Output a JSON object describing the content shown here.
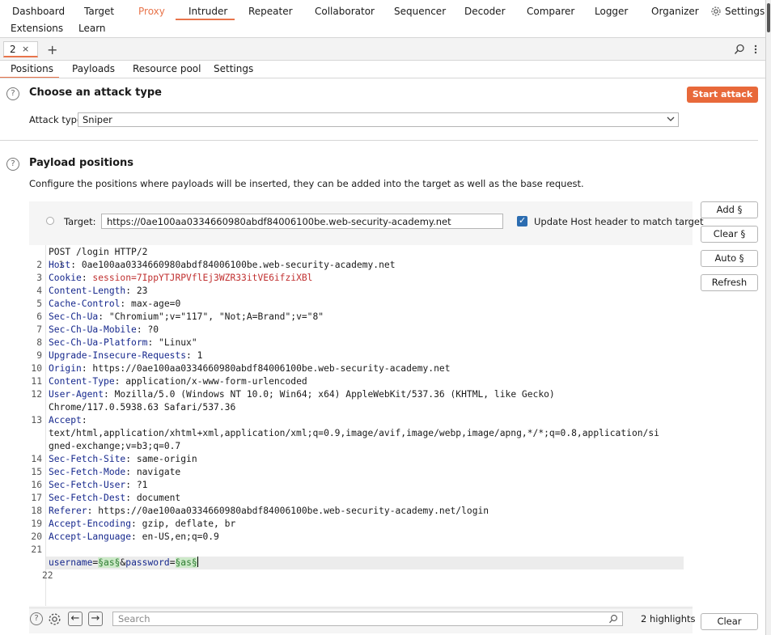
{
  "nav": {
    "row1": [
      "Dashboard",
      "Target",
      "Proxy",
      "Intruder",
      "Repeater",
      "Collaborator",
      "Sequencer",
      "Decoder",
      "Comparer",
      "Logger",
      "Organizer",
      "Settings"
    ],
    "row2": [
      "Extensions",
      "Learn"
    ],
    "active": "Intruder",
    "highlight": "Proxy"
  },
  "tabs": {
    "current": "2",
    "close": "×",
    "add": "+"
  },
  "subtabs": [
    "Positions",
    "Payloads",
    "Resource pool",
    "Settings"
  ],
  "attack": {
    "title": "Choose an attack type",
    "start_label": "Start attack",
    "type_label": "Attack type:",
    "type_value": "Sniper"
  },
  "positions": {
    "title": "Payload positions",
    "description": "Configure the positions where payloads will be inserted, they can be added into the target as well as the base request.",
    "target_label": "Target:",
    "target_value": "https://0ae100aa0334660980abdf84006100be.web-security-academy.net",
    "update_host_label": "Update Host header to match target",
    "buttons": [
      "Add §",
      "Clear §",
      "Auto §",
      "Refresh"
    ]
  },
  "request": {
    "line1": "POST /login HTTP/2",
    "headers": [
      {
        "n": "2",
        "name": "Host",
        "value": "0ae100aa0334660980abdf84006100be.web-security-academy.net"
      },
      {
        "n": "3",
        "name": "Cookie",
        "value": "session=7IppYTJRPVflEj3WZR33itVE6ifziXBl"
      },
      {
        "n": "4",
        "name": "Content-Length",
        "value": "23"
      },
      {
        "n": "5",
        "name": "Cache-Control",
        "value": "max-age=0"
      },
      {
        "n": "6",
        "name": "Sec-Ch-Ua",
        "value": "\"Chromium\";v=\"117\", \"Not;A=Brand\";v=\"8\""
      },
      {
        "n": "7",
        "name": "Sec-Ch-Ua-Mobile",
        "value": "?0"
      },
      {
        "n": "8",
        "name": "Sec-Ch-Ua-Platform",
        "value": "\"Linux\""
      },
      {
        "n": "9",
        "name": "Upgrade-Insecure-Requests",
        "value": "1"
      },
      {
        "n": "10",
        "name": "Origin",
        "value": "https://0ae100aa0334660980abdf84006100be.web-security-academy.net"
      },
      {
        "n": "11",
        "name": "Content-Type",
        "value": "application/x-www-form-urlencoded"
      },
      {
        "n": "12",
        "name": "User-Agent",
        "value": "Mozilla/5.0 (Windows NT 10.0; Win64; x64) AppleWebKit/537.36 (KHTML, like Gecko)"
      },
      {
        "n": "",
        "name": "",
        "value": "Chrome/117.0.5938.63 Safari/537.36"
      },
      {
        "n": "13",
        "name": "Accept",
        "value": ""
      },
      {
        "n": "",
        "name": "",
        "value": "text/html,application/xhtml+xml,application/xml;q=0.9,image/avif,image/webp,image/apng,*/*;q=0.8,application/si"
      },
      {
        "n": "",
        "name": "",
        "value": "gned-exchange;v=b3;q=0.7"
      },
      {
        "n": "14",
        "name": "Sec-Fetch-Site",
        "value": "same-origin"
      },
      {
        "n": "15",
        "name": "Sec-Fetch-Mode",
        "value": "navigate"
      },
      {
        "n": "16",
        "name": "Sec-Fetch-User",
        "value": "?1"
      },
      {
        "n": "17",
        "name": "Sec-Fetch-Dest",
        "value": "document"
      },
      {
        "n": "18",
        "name": "Referer",
        "value": "https://0ae100aa0334660980abdf84006100be.web-security-academy.net/login"
      },
      {
        "n": "19",
        "name": "Accept-Encoding",
        "value": "gzip, deflate, br"
      },
      {
        "n": "20",
        "name": "Accept-Language",
        "value": "en-US,en;q=0.9"
      },
      {
        "n": "21",
        "name": "",
        "value": ""
      }
    ],
    "body_line_num": "22",
    "body": {
      "k1": "username",
      "eq1": "=",
      "m1": "§as§",
      "amp": "&",
      "k2": "password",
      "eq2": "=",
      "m2": "§as§"
    }
  },
  "footer": {
    "search_placeholder": "Search",
    "highlights": "2 highlights",
    "clear_label": "Clear"
  },
  "colors": {
    "accent": "#e8744b",
    "start_button": "#e8693a",
    "header_name": "#16288d",
    "cookie_value": "#c03030"
  }
}
